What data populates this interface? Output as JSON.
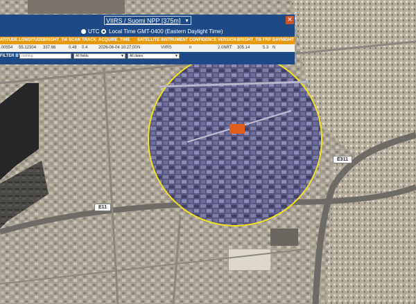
{
  "panel": {
    "layer_select": "VIIRS / Suomi NPP [375m]",
    "close_glyph": "✕",
    "utc_label": "UTC",
    "local_time_label": "Local Time GMT-0400 (Eastern Daylight Time)",
    "time_mode_selected": "local",
    "columns": [
      "ATITUDE",
      "LONGITUDE",
      "BRIGHT_TI4",
      "SCAN",
      "TRACK",
      "ACQUIRE_TIME",
      "SATELLITE",
      "INSTRUMENT",
      "CONFIDENCE",
      "VERSION",
      "BRIGHT_TI5",
      "FRP",
      "DAYNIGHT"
    ],
    "row": [
      ".00554",
      "55.12304",
      "337.66",
      "0.48",
      "0.4",
      "2026-06-04 10:27:00",
      "N",
      "VIIRS",
      "n",
      "2.0NRT",
      "305.14",
      "5.3",
      "N"
    ],
    "filter_label": "FILTER BY",
    "filter_placeholder": "nothing",
    "field_select": "All fields",
    "date_select": "All dates"
  },
  "map": {
    "road_labels": [
      "E11",
      "E311"
    ],
    "colors": {
      "panel_blue": "#1d4a86",
      "header_orange": "#e69a12",
      "radius_circle_stroke": "#f2e21d",
      "radius_circle_fill": "#4b4fa0",
      "fire_pixel": "#e05d1d"
    }
  }
}
